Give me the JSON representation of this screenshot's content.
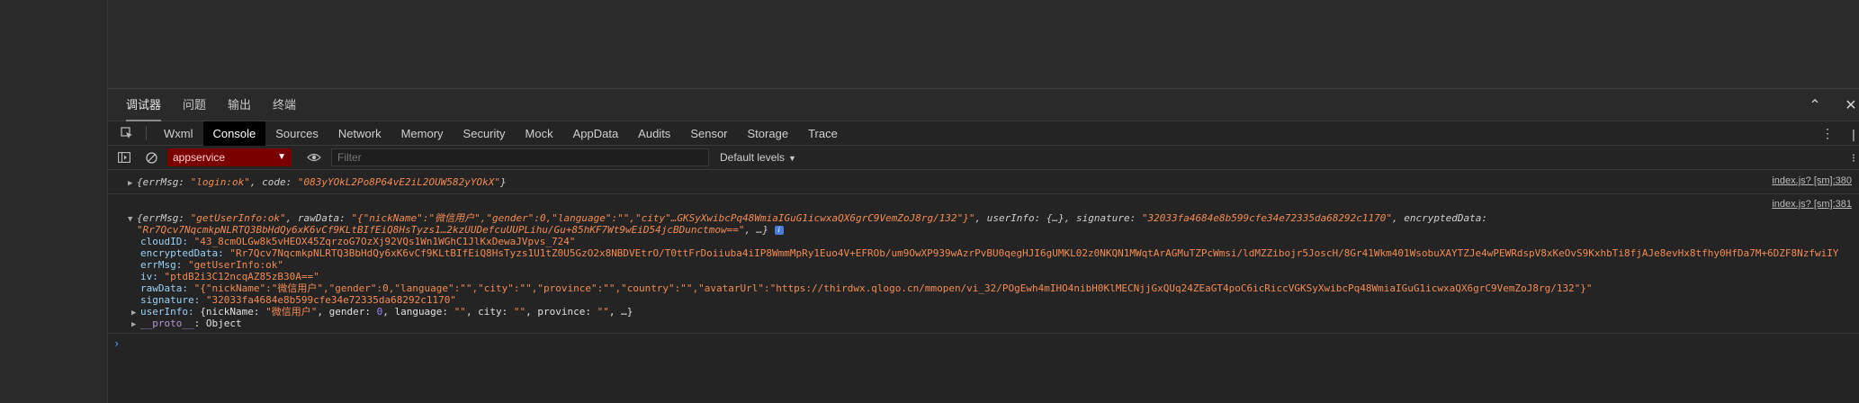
{
  "top_tabs": [
    {
      "label": "调试器",
      "active": true
    },
    {
      "label": "问题",
      "active": false
    },
    {
      "label": "输出",
      "active": false
    },
    {
      "label": "终端",
      "active": false
    }
  ],
  "top_controls": {
    "collapse": "⌃",
    "close": "✕"
  },
  "panel_tabs": [
    {
      "label": "Wxml",
      "active": false
    },
    {
      "label": "Console",
      "active": true
    },
    {
      "label": "Sources",
      "active": false
    },
    {
      "label": "Network",
      "active": false
    },
    {
      "label": "Memory",
      "active": false
    },
    {
      "label": "Security",
      "active": false
    },
    {
      "label": "Mock",
      "active": false
    },
    {
      "label": "AppData",
      "active": false
    },
    {
      "label": "Audits",
      "active": false
    },
    {
      "label": "Sensor",
      "active": false
    },
    {
      "label": "Storage",
      "active": false
    },
    {
      "label": "Trace",
      "active": false
    }
  ],
  "toolbar": {
    "context": "appservice",
    "filter_placeholder": "Filter",
    "levels": "Default levels"
  },
  "messages": {
    "m1": {
      "source": "index.js? [sm]:380",
      "prefix": "{errMsg: ",
      "errMsg": "\"login:ok\"",
      "mid": ", code: ",
      "code": "\"083yYOkL2Po8P64vE2iL2OUW582yYOkX\"",
      "suffix": "}"
    },
    "m2": {
      "source": "index.js? [sm]:381",
      "summary_line1": {
        "p1": "{errMsg: ",
        "errMsg": "\"getUserInfo:ok\"",
        "p2": ", rawData: ",
        "rawData": "\"{\"nickName\":\"微信用户\",\"gender\":0,\"language\":\"\",\"city\"…GKSyXwibcPq48WmiaIGuG1icwxaQX6grC9VemZoJ8rg/132\"}\"",
        "p3": ", userInfo: {…}, signature: ",
        "signature": "\"32033fa4684e8b599cfe34e72335da68292c1170\"",
        "p4": ", encryptedData:"
      },
      "summary_line2": {
        "encrypted": "\"Rr7Qcv7NqcmkpNLRTQ3BbHdQy6xK6vCf9KLtBIfEiQ8HsTyzs1…2kzUUDefcuUUPLihu/Gu+85hKF7Wt9wEiD54jcBDunctmow==\"",
        "tail": ", …}"
      },
      "info_badge": "i",
      "props": {
        "cloudID_key": "cloudID: ",
        "cloudID": "\"43_8cmOLGw8k5vHEOX45ZqrzoG7OzXj92VQs1Wn1WGhC1JlKxDewaJVpvs_724\"",
        "encryptedData_key": "encryptedData: ",
        "encryptedData": "\"Rr7Qcv7NqcmkpNLRTQ3BbHdQy6xK6vCf9KLtBIfEiQ8HsTyzs1U1tZ0U5GzO2x8NBDVEtrO/T0ttFrDoiiuba4iIP8WmmMpRy1Euo4V+EFROb/um9OwXP939wAzrPvBU0qegHJI6gUMKL02z0NKQN1MWqtArAGMuTZPcWmsi/ldMZZibojr5JoscH/8Gr41Wkm401WsobuXAYTZJe4wPEWRdspV8xKeOvS9KxhbTi8fjAJe8evHx8tfhy0HfDa7M+6DZF8NzfwiIY",
        "errMsg_key": "errMsg: ",
        "errMsg": "\"getUserInfo:ok\"",
        "iv_key": "iv: ",
        "iv": "\"ptdB2i3C12ncqAZ85zB30A==\"",
        "rawData_key": "rawData: ",
        "rawData": "\"{\"nickName\":\"微信用户\",\"gender\":0,\"language\":\"\",\"city\":\"\",\"province\":\"\",\"country\":\"\",\"avatarUrl\":\"https://thirdwx.qlogo.cn/mmopen/vi_32/POgEwh4mIHO4nibH0KlMECNjjGxQUq24ZEaGT4poC6icRiccVGKSyXwibcPq48WmiaIGuG1icwxaQX6grC9VemZoJ8rg/132\"}\"",
        "signature_key": "signature: ",
        "signature": "\"32033fa4684e8b599cfe34e72335da68292c1170\"",
        "userInfo_key": "userInfo: ",
        "userInfo_p1": "{nickName: ",
        "userInfo_nick": "\"微信用户\"",
        "userInfo_p2": ", gender: ",
        "userInfo_gender": "0",
        "userInfo_p3": ", language: ",
        "userInfo_lang": "\"\"",
        "userInfo_p4": ", city: ",
        "userInfo_city": "\"\"",
        "userInfo_p5": ", province: ",
        "userInfo_prov": "\"\"",
        "userInfo_p6": ", …}",
        "proto_key": "__proto__",
        "proto_sep": ": ",
        "proto_val": "Object"
      }
    }
  },
  "prompt": "›"
}
